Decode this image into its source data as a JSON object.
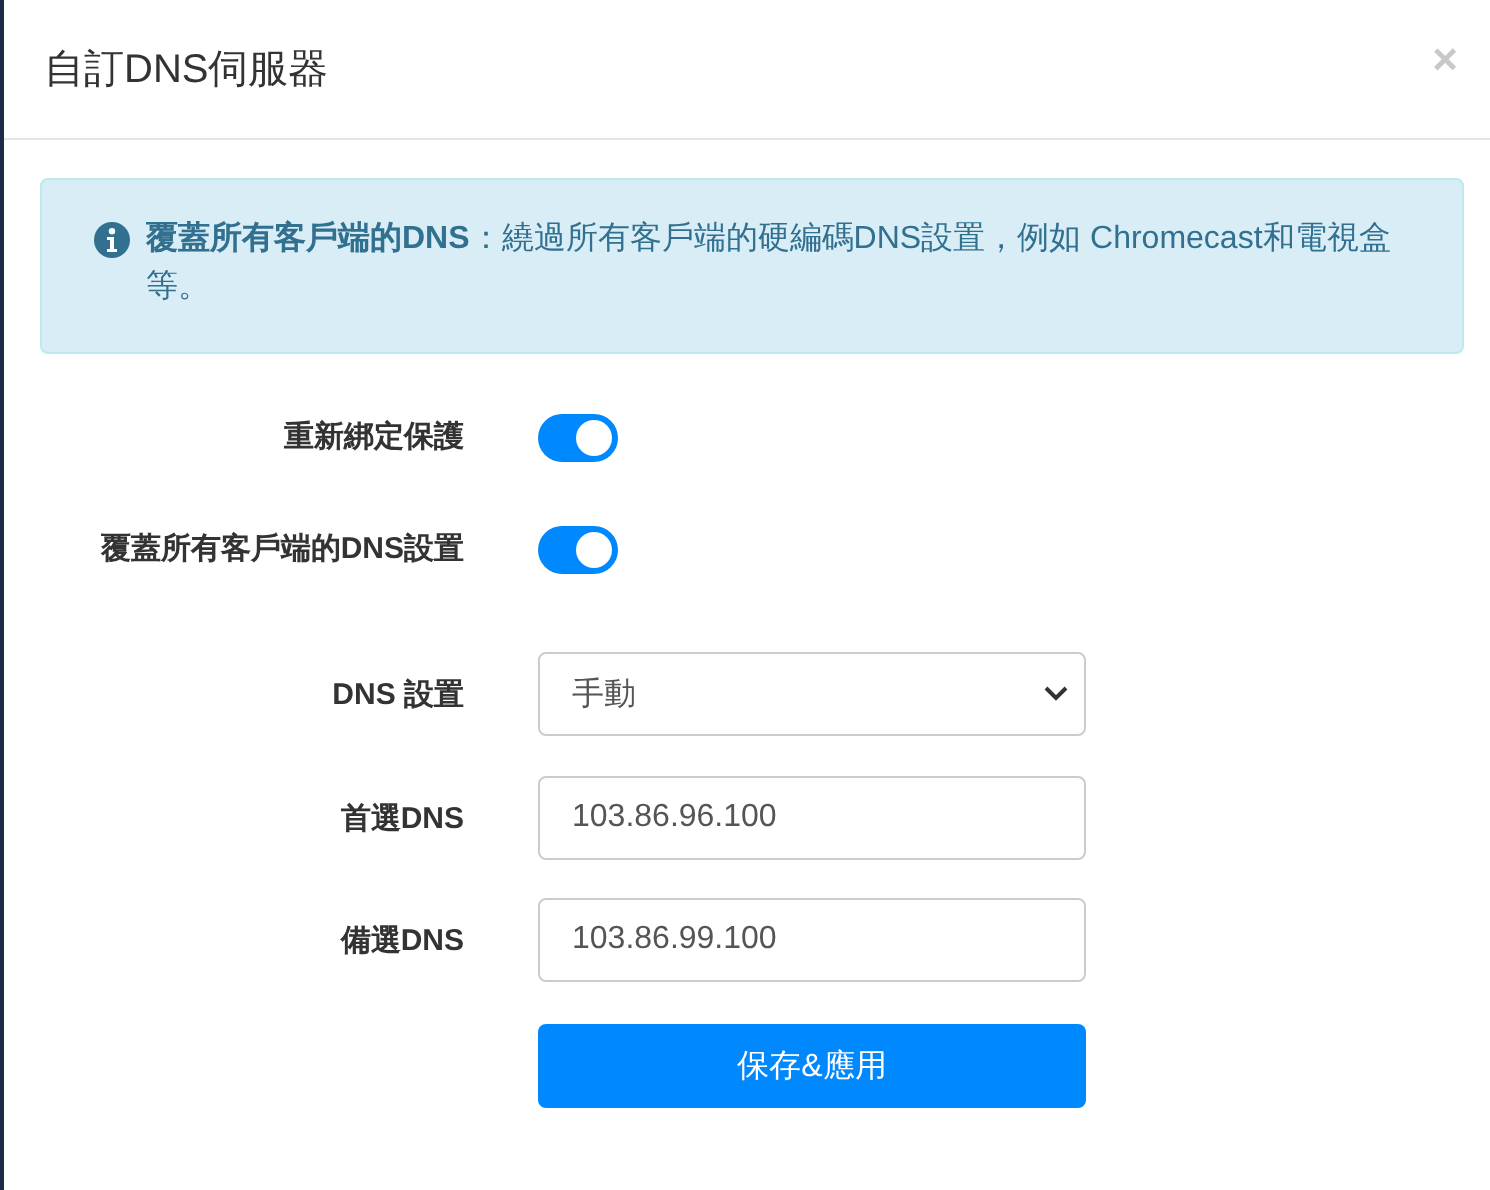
{
  "dialog": {
    "title": "自訂DNS伺服器",
    "close": "×"
  },
  "alert": {
    "text": "**覆蓋所有客戶端的DNS**：繞過所有客戶端的硬編碼DNS設置，例如 Chromecast和電視盒等。"
  },
  "rows": [
    {
      "kind": "toggle",
      "label": "重新綁定保護",
      "on": true
    },
    {
      "kind": "toggle",
      "label": "覆蓋所有客戶端的DNS設置",
      "on": true
    },
    {
      "kind": "select",
      "label": "DNS 設置",
      "value": "手動"
    },
    {
      "kind": "input",
      "label": "首選DNS",
      "value": "103.86.96.100"
    },
    {
      "kind": "input",
      "label": "備選DNS",
      "value": "103.86.99.100"
    }
  ],
  "button": "保存&應用"
}
